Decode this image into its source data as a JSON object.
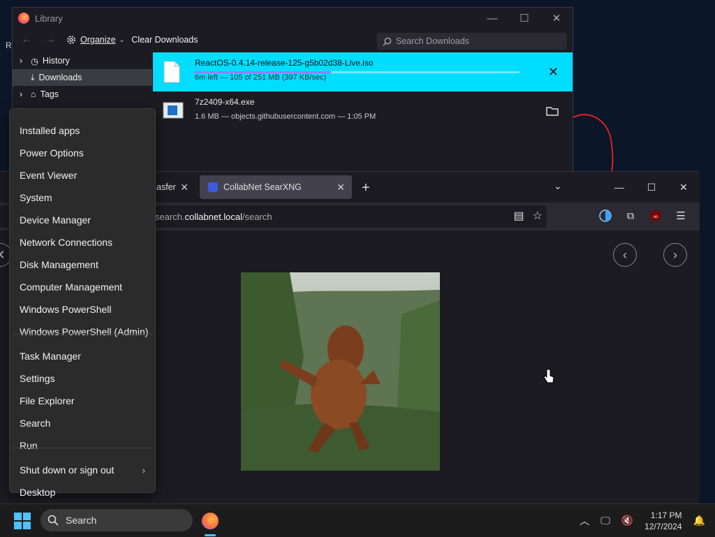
{
  "library": {
    "title": "Library",
    "organize_label": "Organize",
    "clear_downloads_label": "Clear Downloads",
    "search_placeholder": "Search Downloads",
    "sidebar": [
      {
        "label": "History",
        "expandable": true,
        "icon": "history-icon"
      },
      {
        "label": "Downloads",
        "expandable": false,
        "icon": "download-icon",
        "selected": true
      },
      {
        "label": "Tags",
        "expandable": true,
        "icon": "tag-icon"
      }
    ],
    "downloads": [
      {
        "name": "ReactOS-0.4.14-release-125-g5b02d38-Live.iso",
        "status": "6m left — 105 of 251 MB (397 KB/sec)",
        "progress": 0.42,
        "active": true,
        "action_icon": "cancel-icon"
      },
      {
        "name": "7z2409-x64.exe",
        "status": "1.6 MB — objects.githubusercontent.com — 1:05 PM",
        "active": false,
        "action_icon": "folder-icon"
      }
    ]
  },
  "browser": {
    "tabs": [
      {
        "label": "asfer",
        "active": false
      },
      {
        "label": "CollabNet SearXNG",
        "active": true
      }
    ],
    "url_prefix": "search.",
    "url_domain": "collabnet.local",
    "url_path": "/search"
  },
  "context_menu": {
    "items": [
      "Installed apps",
      "Power Options",
      "Event Viewer",
      "System",
      "Device Manager",
      "Network Connections",
      "Disk Management",
      "Computer Management",
      "Windows PowerShell",
      "Windows PowerShell (Admin)",
      "Task Manager",
      "Settings",
      "File Explorer",
      "Search",
      "Run",
      "Shut down or sign out",
      "Desktop"
    ]
  },
  "taskbar": {
    "search_label": "Search",
    "time": "1:17 PM",
    "date": "12/7/2024"
  },
  "colors": {
    "accent": "#00ddff",
    "progress_fill": "#9a7cff",
    "windows_blue": "#4cc2ff"
  }
}
